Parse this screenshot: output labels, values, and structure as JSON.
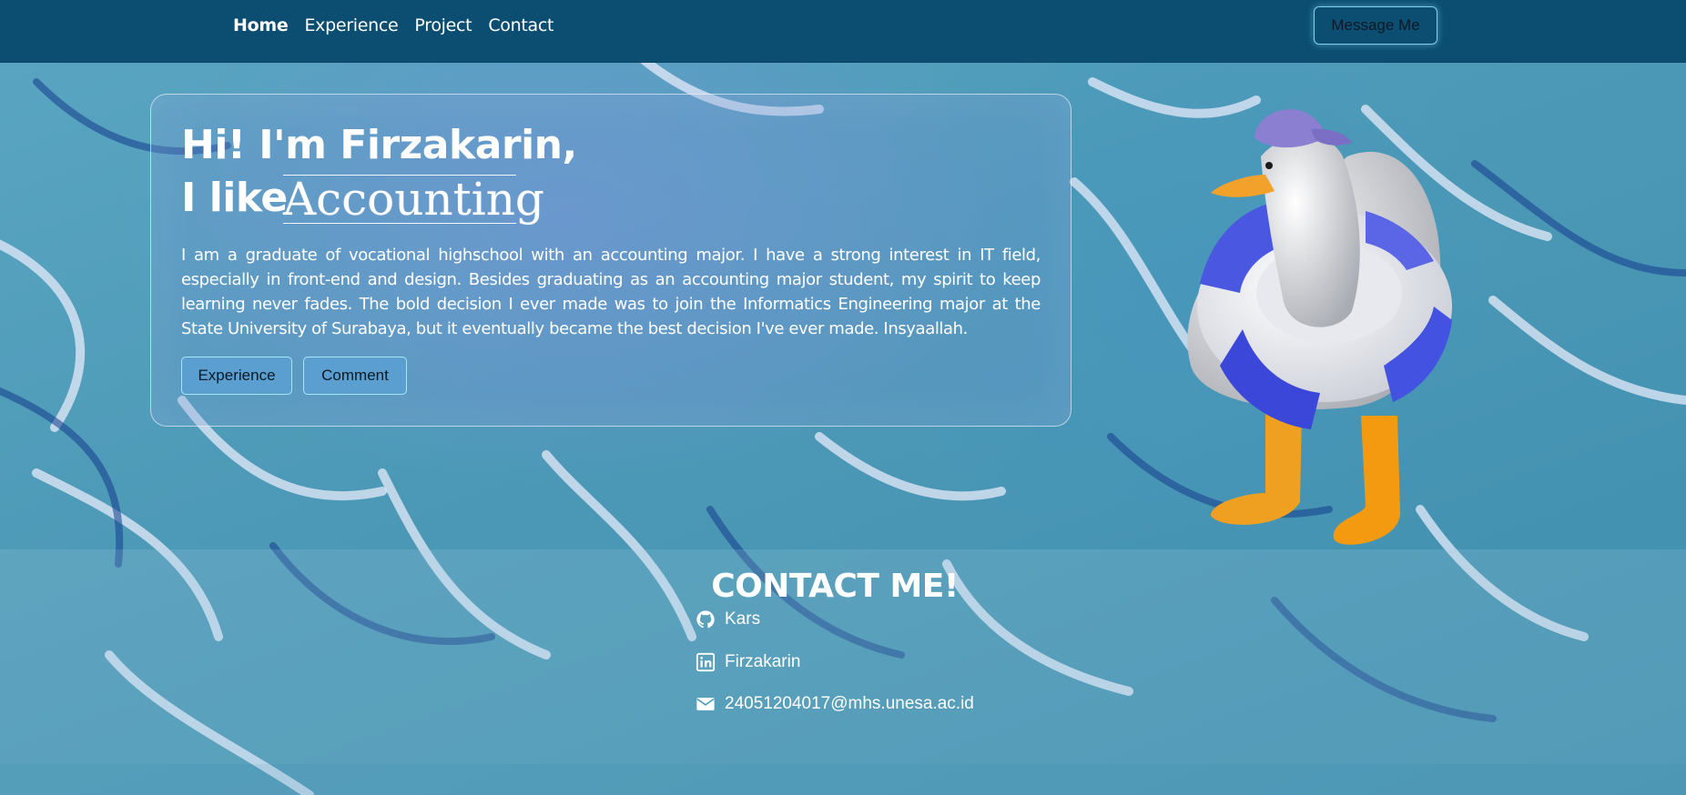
{
  "nav": {
    "links": [
      "Home",
      "Experience",
      "Project",
      "Contact"
    ],
    "active": "Home",
    "message_button": "Message Me"
  },
  "hero": {
    "greeting": "Hi! I'm Firzakarin,",
    "like_prefix": "I like",
    "typed_word": "Accounting",
    "bio": "I am a graduate of vocational highschool with an accounting major. I have a strong interest in IT field, especially in front-end and design. Besides graduating as an accounting major student, my spirit to keep learning never fades. The bold decision I ever made was to join the Informatics Engineering major at the State University of Surabaya, but it eventually became the best decision I've ever made. Insyaallah.",
    "buttons": [
      "Experience",
      "Comment"
    ]
  },
  "contact": {
    "title": "CONTACT ME!",
    "items": [
      {
        "icon": "github-icon",
        "label": "Kars"
      },
      {
        "icon": "linkedin-icon",
        "label": "Firzakarin"
      },
      {
        "icon": "envelope-icon",
        "label": "24051204017@mhs.unesa.ac.id"
      }
    ]
  },
  "colors": {
    "navbar": "#0b4e72",
    "accent_border": "#7fd2ee",
    "background": "#4e9cb8"
  },
  "illustration": "duck-with-swim-ring"
}
